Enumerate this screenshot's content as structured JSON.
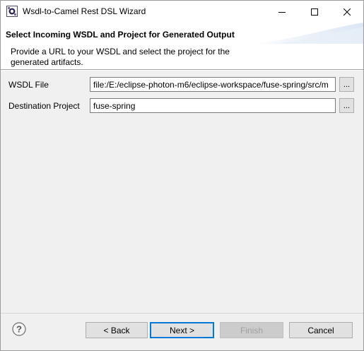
{
  "window": {
    "title": "Wsdl-to-Camel Rest DSL Wizard",
    "icon": "eclipse-wizard-icon"
  },
  "header": {
    "title": "Select Incoming WSDL and Project for Generated Output",
    "description": "Provide a URL to your WSDL and select the project for the generated artifacts."
  },
  "form": {
    "wsdl_label": "WSDL File",
    "wsdl_value": "file:/E:/eclipse-photon-m6/eclipse-workspace/fuse-spring/src/m",
    "wsdl_browse": "...",
    "dest_label": "Destination Project",
    "dest_value": "fuse-spring",
    "dest_browse": "..."
  },
  "buttons": {
    "help": "?",
    "back": "< Back",
    "next": "Next >",
    "finish": "Finish",
    "cancel": "Cancel"
  },
  "colors": {
    "accent": "#0078d7",
    "dialog_bg": "#f0f0f0",
    "disabled_text": "#a0a0a0"
  }
}
